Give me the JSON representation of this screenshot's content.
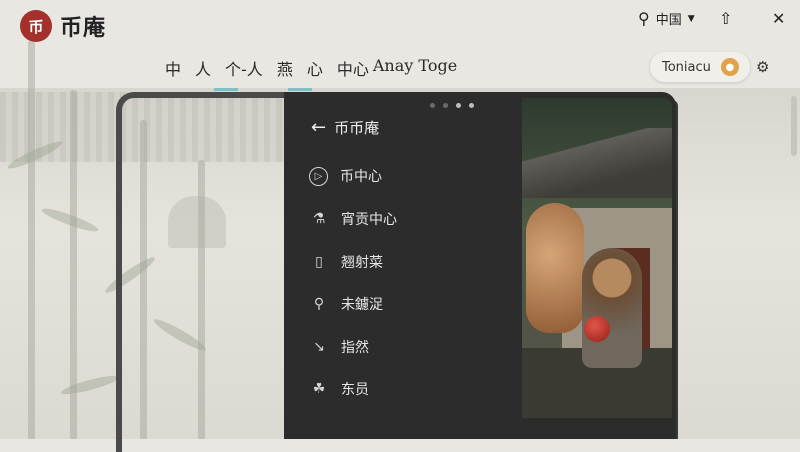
{
  "header": {
    "logo_mark": "币",
    "logo_text": "币庵",
    "nav": [
      "中",
      "人",
      "个-人",
      "燕",
      "心",
      "中心",
      "Anay Toge"
    ],
    "language": "中国",
    "user_name": "Toniacu"
  },
  "drawer": {
    "title": "币币庵",
    "items": [
      {
        "label": "币中心",
        "icon": "play-circle-icon"
      },
      {
        "label": "宵贡中心",
        "icon": "microscope-icon"
      },
      {
        "label": "翘射菜",
        "icon": "phone-icon"
      },
      {
        "label": "未鑢浞",
        "icon": "shapes-icon"
      },
      {
        "label": "指然",
        "icon": "slope-icon"
      },
      {
        "label": "东员",
        "icon": "bowl-icon"
      }
    ]
  },
  "colors": {
    "brand": "#a3302a",
    "accent": "#7cc1c8",
    "panel": "#2c2c2c"
  }
}
